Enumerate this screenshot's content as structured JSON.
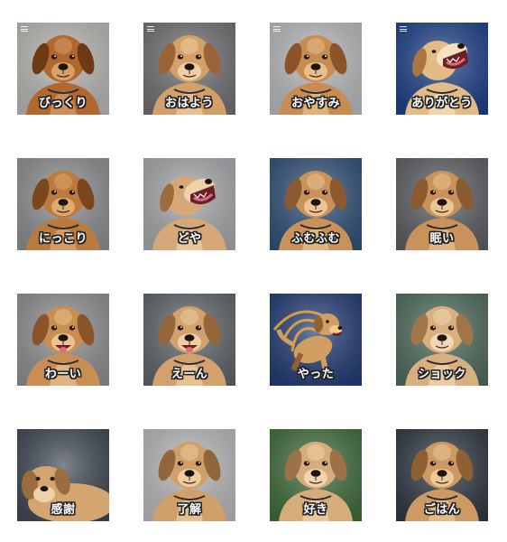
{
  "stickers": [
    {
      "label": "びっくり",
      "bg": "#b9b6b3",
      "fur": "#b0682e",
      "dark": "#6e3a16",
      "light": "#d9a06a",
      "pose": "front",
      "menu": true
    },
    {
      "label": "おはよう",
      "bg": "#6f6f73",
      "fur": "#d3a06a",
      "dark": "#9c6436",
      "light": "#efcfa2",
      "pose": "front",
      "menu": true
    },
    {
      "label": "おやすみ",
      "bg": "#b7b9bc",
      "fur": "#c78c52",
      "dark": "#8a5328",
      "light": "#e9c08d",
      "pose": "front",
      "menu": true
    },
    {
      "label": "ありがとう",
      "bg": "#1b3f86",
      "fur": "#e2bb86",
      "dark": "#a9773f",
      "light": "#f6e1bf",
      "pose": "howl",
      "menu": true
    },
    {
      "label": "にっこり",
      "bg": "#8b8d90",
      "fur": "#bb7a3e",
      "dark": "#7a461c",
      "light": "#dfaa72",
      "pose": "front",
      "menu": false
    },
    {
      "label": "どや",
      "bg": "#a5a7aa",
      "fur": "#d6a877",
      "dark": "#9c6c3e",
      "light": "#f0d2aa",
      "pose": "howl",
      "menu": false
    },
    {
      "label": "ふむふむ",
      "bg": "#2f4f77",
      "fur": "#c8925a",
      "dark": "#8b5a2e",
      "light": "#ebc594",
      "pose": "front",
      "menu": false
    },
    {
      "label": "眠い",
      "bg": "#5b5d62",
      "fur": "#c9925a",
      "dark": "#8b5a2e",
      "light": "#ebc594",
      "pose": "front",
      "menu": false
    },
    {
      "label": "わーい",
      "bg": "#8e8e92",
      "fur": "#c98e52",
      "dark": "#8b5428",
      "light": "#ecc38f",
      "pose": "smile",
      "menu": false
    },
    {
      "label": "えーん",
      "bg": "#5e6368",
      "fur": "#d2a16d",
      "dark": "#95663a",
      "light": "#f0cfa2",
      "pose": "smile",
      "menu": false
    },
    {
      "label": "やった",
      "bg": "#213a73",
      "fur": "#d29f62",
      "dark": "#93612f",
      "light": "#f0c98f",
      "pose": "jump",
      "menu": false
    },
    {
      "label": "ショック",
      "bg": "#4d6a5a",
      "fur": "#d8b080",
      "dark": "#a07648",
      "light": "#f2d8b4",
      "pose": "front",
      "menu": false
    },
    {
      "label": "感謝",
      "bg": "#3d4650",
      "fur": "#d4a570",
      "dark": "#9a6c3f",
      "light": "#f0d0a6",
      "pose": "lying",
      "menu": false
    },
    {
      "label": "了解",
      "bg": "#b8b8ba",
      "fur": "#d0a06a",
      "dark": "#93653a",
      "light": "#eecda0",
      "pose": "front",
      "menu": false
    },
    {
      "label": "好き",
      "bg": "#3e6b3a",
      "fur": "#d6ac7a",
      "dark": "#9d7248",
      "light": "#f1d3ad",
      "pose": "front",
      "menu": false
    },
    {
      "label": "ごはん",
      "bg": "#2e3640",
      "fur": "#cc9a62",
      "dark": "#8f6034",
      "light": "#ecc99a",
      "pose": "front",
      "menu": false
    }
  ]
}
